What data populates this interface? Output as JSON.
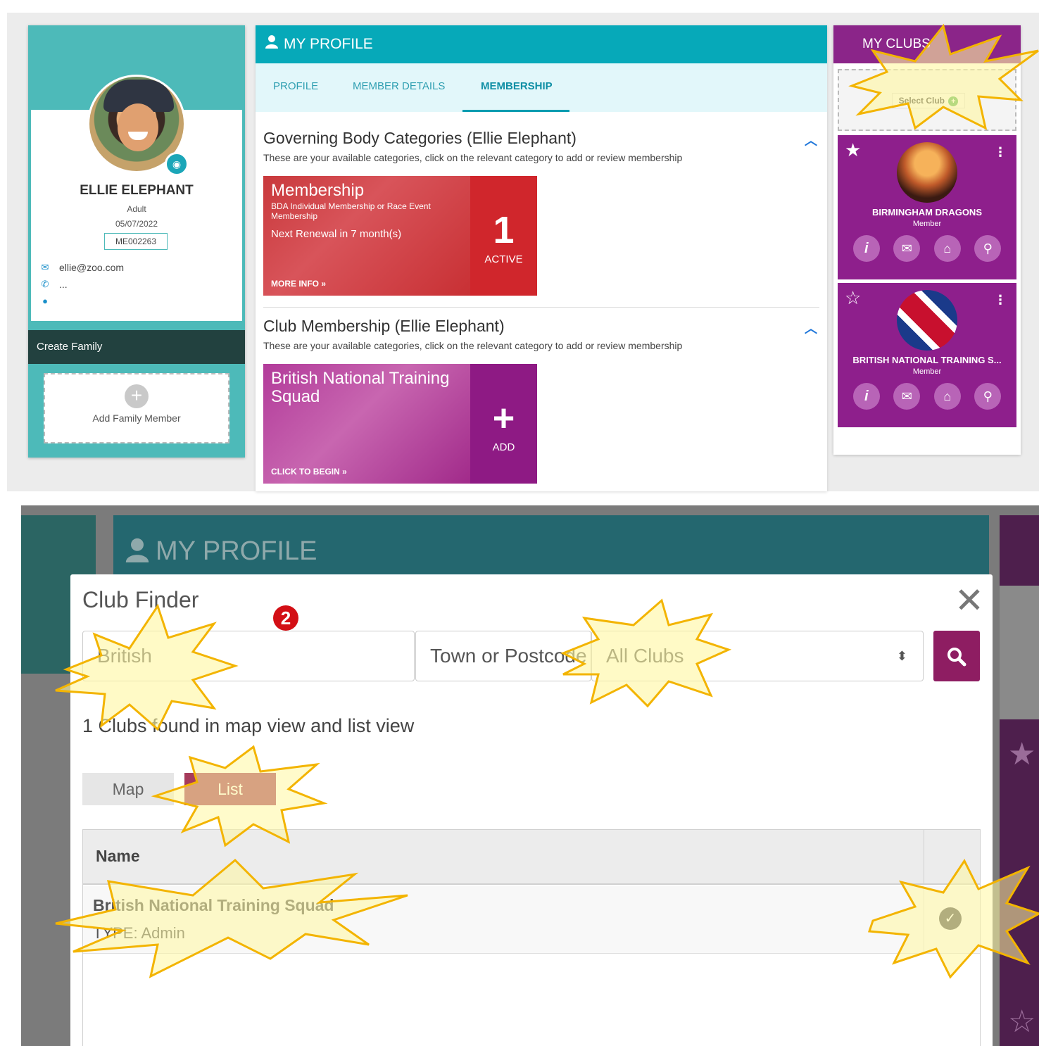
{
  "top": {
    "profile": {
      "name": "ELLIE ELEPHANT",
      "type": "Adult",
      "date": "05/07/2022",
      "member_id": "ME002263",
      "email": "ellie@zoo.com",
      "phone": "...",
      "create_family": "Create Family",
      "add_family_member": "Add Family Member"
    },
    "main": {
      "header": "MY PROFILE",
      "tabs": [
        "PROFILE",
        "MEMBER DETAILS",
        "MEMBERSHIP"
      ],
      "active_tab": "MEMBERSHIP",
      "sections": [
        {
          "title": "Governing Body Categories (Ellie Elephant)",
          "subtitle": "These are your available categories, click on the relevant category to add or review membership",
          "tile": {
            "title": "Membership",
            "subtitle": "BDA Individual Membership or Race Event Membership",
            "renewal": "Next Renewal in 7 month(s)",
            "link": "MORE INFO »",
            "count": "1",
            "status": "ACTIVE"
          }
        },
        {
          "title": "Club Membership (Ellie Elephant)",
          "subtitle": "These are your available categories, click on the relevant category to add or review membership",
          "tile": {
            "title": "British National Training Squad",
            "link": "CLICK TO BEGIN »",
            "action_symbol": "+",
            "status": "ADD"
          }
        }
      ]
    },
    "clubs": {
      "header": "MY CLUBS",
      "select_club": "Select Club",
      "list": [
        {
          "name": "BIRMINGHAM DRAGONS",
          "role": "Member",
          "favorite": true
        },
        {
          "name": "BRITISH NATIONAL TRAINING S...",
          "role": "Member",
          "favorite": false
        }
      ]
    }
  },
  "bottom": {
    "bg_header": "MY PROFILE",
    "modal": {
      "title": "Club Finder",
      "step_marker": "❷",
      "search_value": "British",
      "town_placeholder": "Town or Postcode",
      "club_filter": "All Clubs",
      "results_text": "1 Clubs found in map view and list view",
      "view_toggle": [
        "Map",
        "List"
      ],
      "active_view": "List",
      "table": {
        "header": "Name",
        "rows": [
          {
            "name": "British National Training Squad",
            "type": "TYPE: Admin"
          }
        ]
      }
    }
  },
  "colors": {
    "teal": "#06a9b9",
    "left_card": "#4dbab9",
    "purple": "#8e1f8c",
    "red_tile": "#d0262c",
    "search_btn": "#8e1d62",
    "list_btn": "#a63b5b"
  },
  "icons": [
    "camera-icon",
    "envelope-icon",
    "phone-icon",
    "map-pin-icon",
    "person-icon",
    "chevron-up-icon",
    "star-icon",
    "kebab-icon",
    "info-icon",
    "mail-icon",
    "home-icon",
    "location-icon",
    "close-icon",
    "search-icon",
    "check-icon",
    "sort-arrows-icon"
  ]
}
